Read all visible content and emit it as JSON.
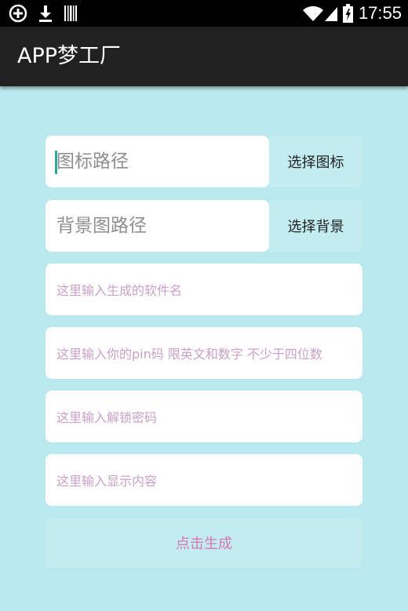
{
  "status_bar": {
    "time": "17:55",
    "left_icons": [
      "add-circle-icon",
      "download-icon",
      "barcode-icon"
    ],
    "right_icons": [
      "wifi-icon",
      "signal-icon",
      "battery-icon"
    ]
  },
  "action_bar": {
    "title": "APP梦工厂"
  },
  "form": {
    "icon_path_placeholder": "图标路径",
    "select_icon_label": "选择图标",
    "background_path_placeholder": "背景图路径",
    "select_background_label": "选择背景",
    "app_name_placeholder": "这里输入生成的软件名",
    "pin_placeholder": "这里输入你的pin码 限英文和数字 不少于四位数",
    "unlock_password_placeholder": "这里输入解锁密码",
    "display_content_placeholder": "这里输入显示内容",
    "generate_label": "点击生成"
  },
  "colors": {
    "background": "#b9e9ee",
    "action_bar": "#212121",
    "button_bg": "#c3ecf0",
    "hint_text": "#c9a1c6",
    "generate_text": "#d977b4",
    "cursor": "#2fa89c"
  }
}
